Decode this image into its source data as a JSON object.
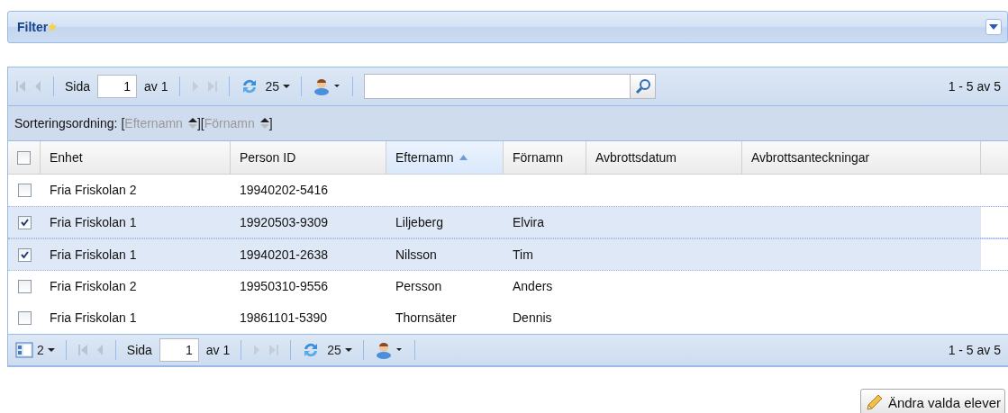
{
  "filter_panel": {
    "title": "Filter"
  },
  "top_toolbar": {
    "page_label": "Sida",
    "page": "1",
    "page_of": "av 1",
    "page_size": "25",
    "summary": "1 - 5 av 5"
  },
  "sort_bar": {
    "label": "Sorteringsordning:",
    "open": "[",
    "close": "]",
    "fields": [
      "Efternamn",
      "Förnamn"
    ]
  },
  "table": {
    "all_checked": false,
    "columns": [
      {
        "label": "Enhet",
        "sorted": false
      },
      {
        "label": "Person ID",
        "sorted": false
      },
      {
        "label": "Efternamn",
        "sorted": true
      },
      {
        "label": "Förnamn",
        "sorted": false
      },
      {
        "label": "Avbrottsdatum",
        "sorted": false
      },
      {
        "label": "Avbrottsanteckningar",
        "sorted": false
      }
    ],
    "rows": [
      {
        "checked": false,
        "cells": [
          "Fria Friskolan 2",
          "19940202-5416"
        ]
      },
      {
        "checked": true,
        "cells": [
          "Fria Friskolan 1",
          "19920503-9309",
          "Liljeberg",
          "Elvira"
        ]
      },
      {
        "checked": true,
        "cells": [
          "Fria Friskolan 1",
          "19940201-2638",
          "Nilsson",
          "Tim"
        ]
      },
      {
        "checked": false,
        "cells": [
          "Fria Friskolan 2",
          "19950310-9556",
          "Persson",
          "Anders"
        ]
      },
      {
        "checked": false,
        "cells": [
          "Fria Friskolan 1",
          "19861101-5390",
          "Thornsäter",
          "Dennis"
        ]
      }
    ]
  },
  "bottom_toolbar": {
    "column_count": "2",
    "page_label": "Sida",
    "page": "1",
    "page_of": "av 1",
    "page_size": "25",
    "summary": "1 - 5 av 5"
  },
  "action_button": {
    "label": "Ändra valda elever"
  }
}
